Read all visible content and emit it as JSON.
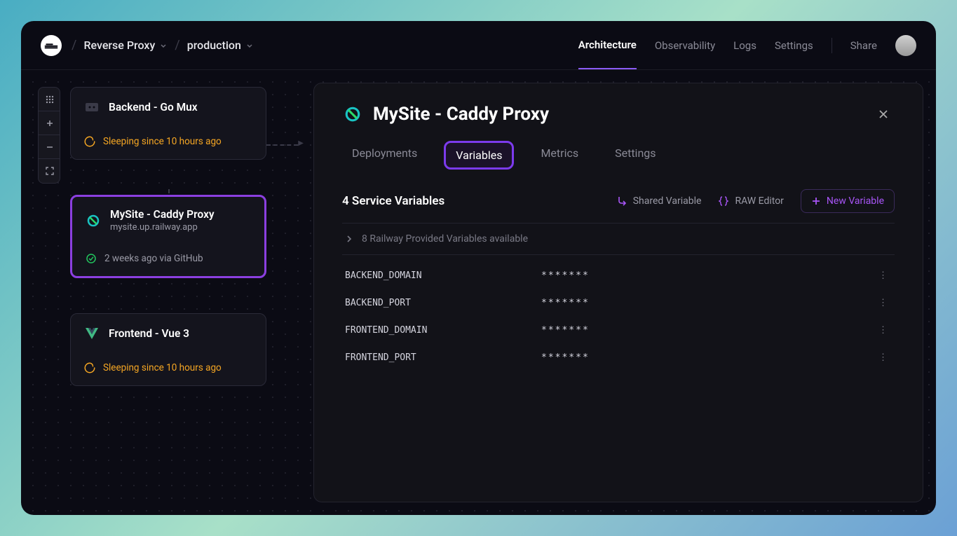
{
  "breadcrumb": {
    "project": "Reverse Proxy",
    "env": "production"
  },
  "nav": {
    "architecture": "Architecture",
    "observability": "Observability",
    "logs": "Logs",
    "settings": "Settings",
    "share": "Share"
  },
  "services": {
    "backend": {
      "name": "Backend - Go Mux",
      "status": "Sleeping since 10 hours ago"
    },
    "caddy": {
      "name": "MySite - Caddy Proxy",
      "domain": "mysite.up.railway.app",
      "status": "2 weeks ago via GitHub"
    },
    "frontend": {
      "name": "Frontend - Vue 3",
      "status": "Sleeping since 10 hours ago"
    }
  },
  "panel": {
    "title": "MySite - Caddy Proxy",
    "tabs": {
      "deployments": "Deployments",
      "variables": "Variables",
      "metrics": "Metrics",
      "settings": "Settings"
    },
    "count_label": "4 Service Variables",
    "actions": {
      "shared": "Shared Variable",
      "raw": "RAW Editor",
      "new": "New Variable"
    },
    "provided": "8 Railway Provided Variables available",
    "vars": [
      {
        "k": "BACKEND_DOMAIN",
        "v": "*******"
      },
      {
        "k": "BACKEND_PORT",
        "v": "*******"
      },
      {
        "k": "FRONTEND_DOMAIN",
        "v": "*******"
      },
      {
        "k": "FRONTEND_PORT",
        "v": "*******"
      }
    ]
  }
}
